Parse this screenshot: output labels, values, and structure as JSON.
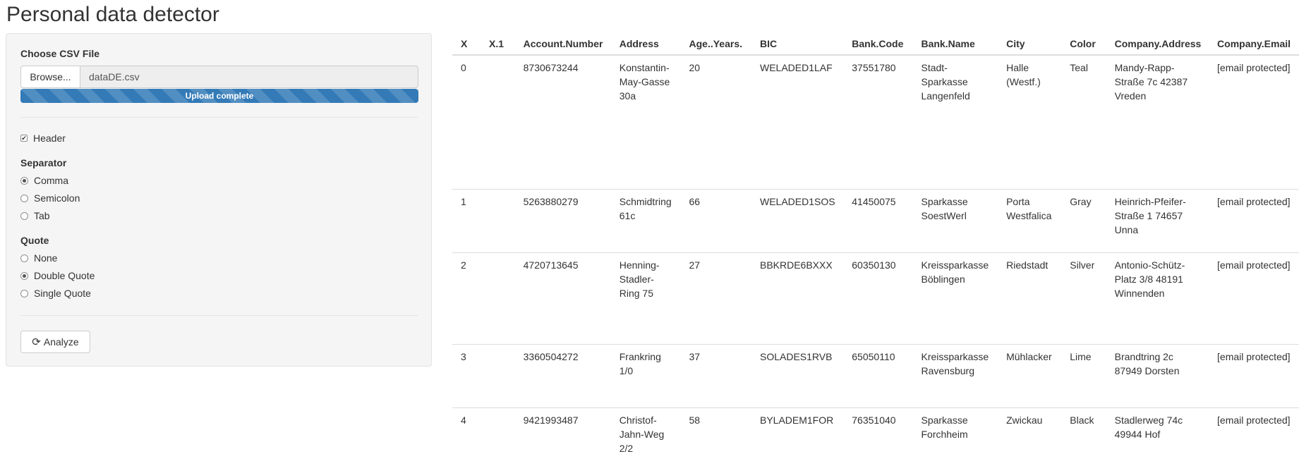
{
  "app": {
    "title": "Personal data detector"
  },
  "sidebar": {
    "file_label": "Choose CSV File",
    "browse_label": "Browse...",
    "file_name": "dataDE.csv",
    "progress_text": "Upload complete",
    "progress_percent": 100,
    "header_label": "Header",
    "header_checked": true,
    "separator_label": "Separator",
    "separator_options": [
      "Comma",
      "Semicolon",
      "Tab"
    ],
    "separator_selected": "Comma",
    "quote_label": "Quote",
    "quote_options": [
      "None",
      "Double Quote",
      "Single Quote"
    ],
    "quote_selected": "Double Quote",
    "analyze_label": "Analyze",
    "analyze_icon": "refresh-icon"
  },
  "table": {
    "columns": [
      "X",
      "X.1",
      "Account.Number",
      "Address",
      "Age..Years.",
      "BIC",
      "Bank.Code",
      "Bank.Name",
      "City",
      "Color",
      "Company.Address",
      "Company.Email"
    ],
    "rows": [
      [
        "0",
        "",
        "8730673244",
        "Konstantin-May-Gasse 30a",
        "20",
        "WELADED1LAF",
        "37551780",
        "Stadt-Sparkasse Langenfeld",
        "Halle (Westf.)",
        "Teal",
        "Mandy-Rapp-Straße 7c 42387 Vreden",
        "[email protected]"
      ],
      [
        "1",
        "",
        "5263880279",
        "Schmidtring 61c",
        "66",
        "WELADED1SOS",
        "41450075",
        "Sparkasse SoestWerl",
        "Porta Westfalica",
        "Gray",
        "Heinrich-Pfeifer-Straße 1 74657 Unna",
        "[email protected]"
      ],
      [
        "2",
        "",
        "4720713645",
        "Henning-Stadler-Ring 75",
        "27",
        "BBKRDE6BXXX",
        "60350130",
        "Kreissparkasse Böblingen",
        "Riedstadt",
        "Silver",
        "Antonio-Schütz-Platz 3/8 48191 Winnenden",
        "[email protected]"
      ],
      [
        "3",
        "",
        "3360504272",
        "Frankring 1/0",
        "37",
        "SOLADES1RVB",
        "65050110",
        "Kreissparkasse Ravensburg",
        "Mühlacker",
        "Lime",
        "Brandtring 2c 87949 Dorsten",
        "[email protected]"
      ],
      [
        "4",
        "",
        "9421993487",
        "Christof-Jahn-Weg 2/2",
        "58",
        "BYLADEM1FOR",
        "76351040",
        "Sparkasse Forchheim",
        "Zwickau",
        "Black",
        "Stadlerweg 74c 49944 Hof",
        "[email protected]"
      ]
    ]
  }
}
